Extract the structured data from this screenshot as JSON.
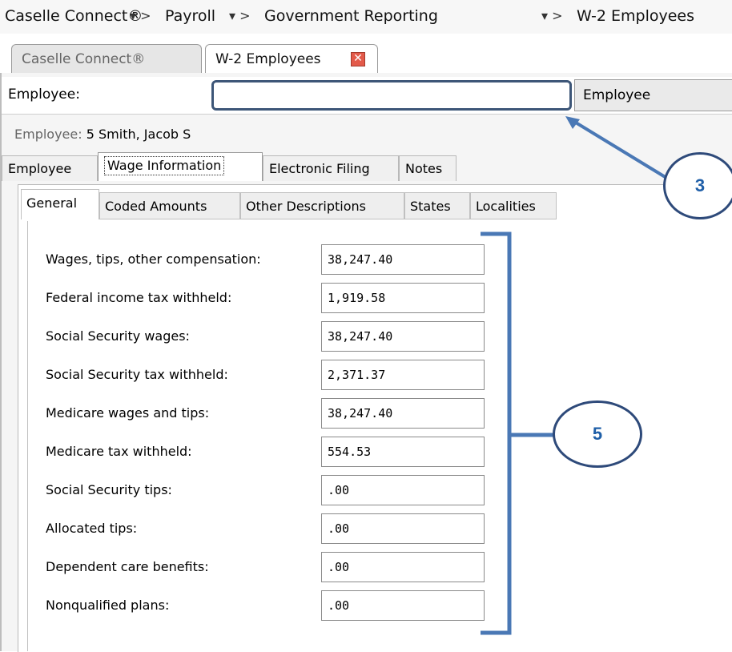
{
  "breadcrumb": {
    "items": [
      "Caselle Connect®",
      "Payroll",
      "Government Reporting",
      "W-2 Employees"
    ],
    "separator": "▾ >"
  },
  "doc_tabs": {
    "tab1": "Caselle Connect®",
    "tab2": "W-2 Employees",
    "close_glyph": "✕"
  },
  "lookup": {
    "label": "Employee:",
    "value": "",
    "button": "Employee"
  },
  "employee_line": {
    "label": "Employee:",
    "number": "5",
    "name": "Smith, Jacob S"
  },
  "main_tabs": [
    "Employee",
    "Wage Information",
    "Electronic Filing",
    "Notes"
  ],
  "sub_tabs": [
    "General",
    "Coded Amounts",
    "Other Descriptions",
    "States",
    "Localities"
  ],
  "fields": [
    {
      "label": "Wages, tips, other compensation:",
      "value": "38,247.40"
    },
    {
      "label": "Federal income tax withheld:",
      "value": "1,919.58"
    },
    {
      "label": "Social Security wages:",
      "value": "38,247.40"
    },
    {
      "label": "Social Security tax withheld:",
      "value": "2,371.37"
    },
    {
      "label": "Medicare wages and tips:",
      "value": "38,247.40"
    },
    {
      "label": "Medicare tax withheld:",
      "value": "554.53"
    },
    {
      "label": "Social Security tips:",
      "value": ".00"
    },
    {
      "label": "Allocated tips:",
      "value": ".00"
    },
    {
      "label": "Dependent care benefits:",
      "value": ".00"
    },
    {
      "label": "Nonqualified plans:",
      "value": ".00"
    }
  ],
  "callouts": {
    "lookup": "3",
    "fields": "5"
  },
  "colors": {
    "callout_border": "#2e4a7a",
    "callout_text": "#1f5fa8",
    "bracket": "#4a78b5"
  }
}
